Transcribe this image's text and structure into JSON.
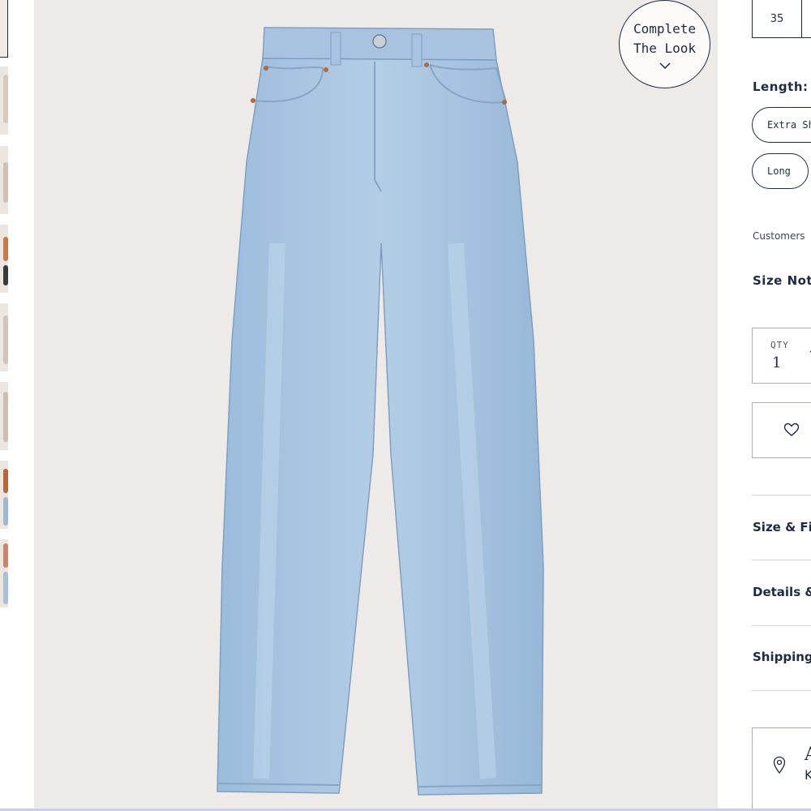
{
  "thumbnails": [
    {
      "name": "thumbnail-1",
      "selected": true
    },
    {
      "name": "thumbnail-2"
    },
    {
      "name": "thumbnail-3"
    },
    {
      "name": "thumbnail-4"
    },
    {
      "name": "thumbnail-5"
    },
    {
      "name": "thumbnail-6"
    },
    {
      "name": "thumbnail-7"
    },
    {
      "name": "thumbnail-8"
    }
  ],
  "product_image": {
    "subject": "light wash jeans"
  },
  "complete_look": {
    "line1": "Complete",
    "line2": "The Look"
  },
  "size": {
    "visible_value": "35"
  },
  "length": {
    "label": "Length:",
    "options": [
      "Extra Short",
      "Long"
    ]
  },
  "fit_note": "Customers",
  "size_not": "Size Not",
  "quantity": {
    "label": "QTY",
    "value": "1"
  },
  "wishlist": {
    "icon": "heart-icon"
  },
  "accordions": [
    "Size & Fit",
    "Details &",
    "Shipping"
  ],
  "store": {
    "initial": "A",
    "sub": "K"
  },
  "colors": {
    "navy": "#1f2a44",
    "background": "#eeeae7",
    "denim": "#a9c5e0"
  }
}
